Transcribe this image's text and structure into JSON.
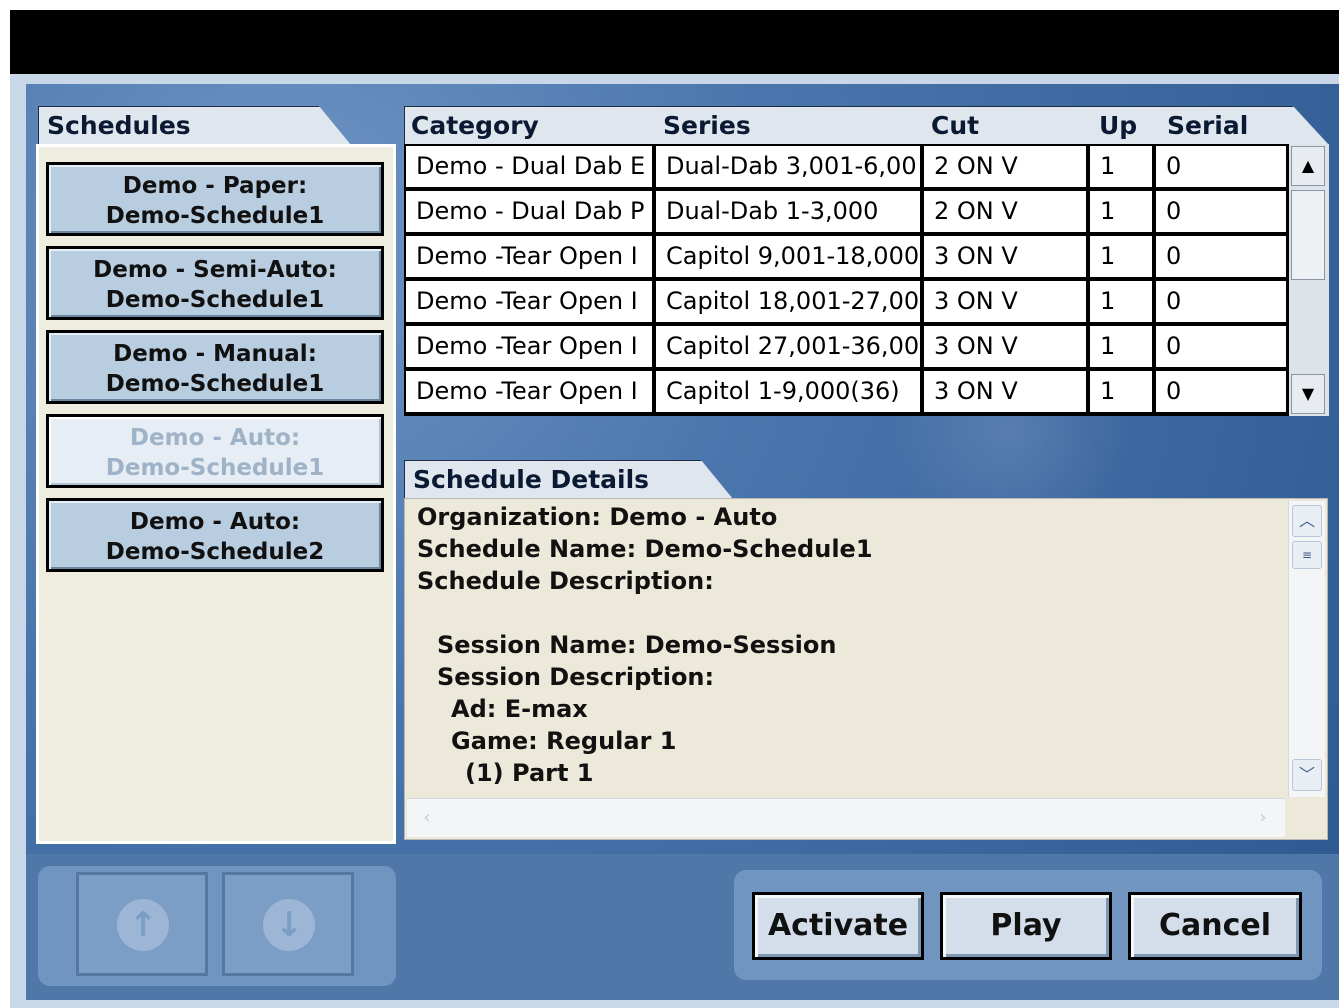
{
  "schedules": {
    "tab_label": "Schedules",
    "items": [
      {
        "line1": "Demo - Paper:",
        "line2": "Demo-Schedule1"
      },
      {
        "line1": "Demo - Semi-Auto:",
        "line2": "Demo-Schedule1"
      },
      {
        "line1": "Demo - Manual:",
        "line2": "Demo-Schedule1"
      },
      {
        "line1": "Demo - Auto:",
        "line2": "Demo-Schedule1"
      },
      {
        "line1": "Demo - Auto:",
        "line2": "Demo-Schedule2"
      }
    ]
  },
  "grid": {
    "headers": [
      "Category",
      "Series",
      "Cut",
      "Up",
      "Serial"
    ],
    "rows": [
      [
        "Demo - Dual Dab E",
        "Dual-Dab 3,001-6,00",
        "2 ON V",
        "1",
        "0"
      ],
      [
        "Demo - Dual Dab P",
        "Dual-Dab 1-3,000",
        "2 ON V",
        "1",
        "0"
      ],
      [
        "Demo -Tear Open I",
        "Capitol 9,001-18,000",
        "3 ON V",
        "1",
        "0"
      ],
      [
        "Demo -Tear Open I",
        "Capitol 18,001-27,00",
        "3 ON V",
        "1",
        "0"
      ],
      [
        "Demo -Tear Open I",
        "Capitol 27,001-36,00",
        "3 ON V",
        "1",
        "0"
      ],
      [
        "Demo -Tear Open I",
        "Capitol 1-9,000(36)",
        "3 ON V",
        "1",
        "0"
      ]
    ]
  },
  "details": {
    "tab_label": "Schedule Details",
    "lines": [
      "Organization: Demo - Auto",
      "Schedule Name: Demo-Schedule1",
      "Schedule Description:",
      "Session Name: Demo-Session",
      "Session Description:",
      "Ad: E-max",
      "Game: Regular 1",
      "(1) Part 1"
    ]
  },
  "buttons": {
    "activate": "Activate",
    "play": "Play",
    "cancel": "Cancel"
  },
  "icons": {
    "up": "arrow-up-icon",
    "down": "arrow-down-icon"
  }
}
